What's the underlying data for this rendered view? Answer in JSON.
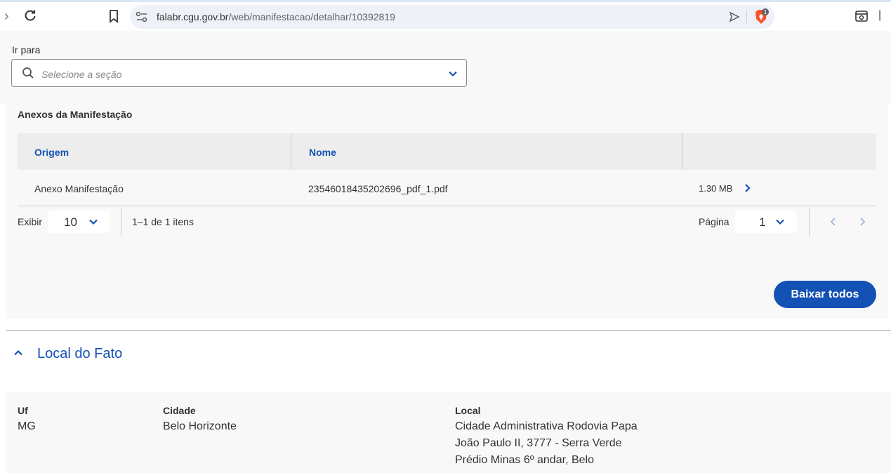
{
  "browser": {
    "url_domain": "falabr.cgu.gov.br",
    "url_path": "/web/manifestacao/detalhar/10392819",
    "brave_badge": "1"
  },
  "goto": {
    "label": "Ir para",
    "placeholder": "Selecione a seção"
  },
  "anexos": {
    "title": "Anexos da Manifestação",
    "columns": [
      "Origem",
      "Nome",
      ""
    ],
    "rows": [
      {
        "origem": "Anexo Manifestação",
        "nome": "23546018435202696_pdf_1.pdf",
        "size": "1.30 MB"
      }
    ],
    "pager": {
      "exibir_label": "Exibir",
      "per_page": "10",
      "range": "1–1 de 1 itens",
      "page_label": "Página",
      "page": "1"
    },
    "download_all_label": "Baixar todos"
  },
  "local_do_fato": {
    "title": "Local do Fato",
    "uf_label": "Uf",
    "uf_value": "MG",
    "cidade_label": "Cidade",
    "cidade_value": "Belo Horizonte",
    "local_label": "Local",
    "local_lines": [
      "Cidade Administrativa Rodovia Papa",
      "João Paulo II, 3777 - Serra Verde",
      "Prédio Minas 6º andar, Belo"
    ]
  },
  "colors": {
    "primary": "#1351b4",
    "panel_bg": "#f8f8f8",
    "header_bg": "#ededed"
  }
}
